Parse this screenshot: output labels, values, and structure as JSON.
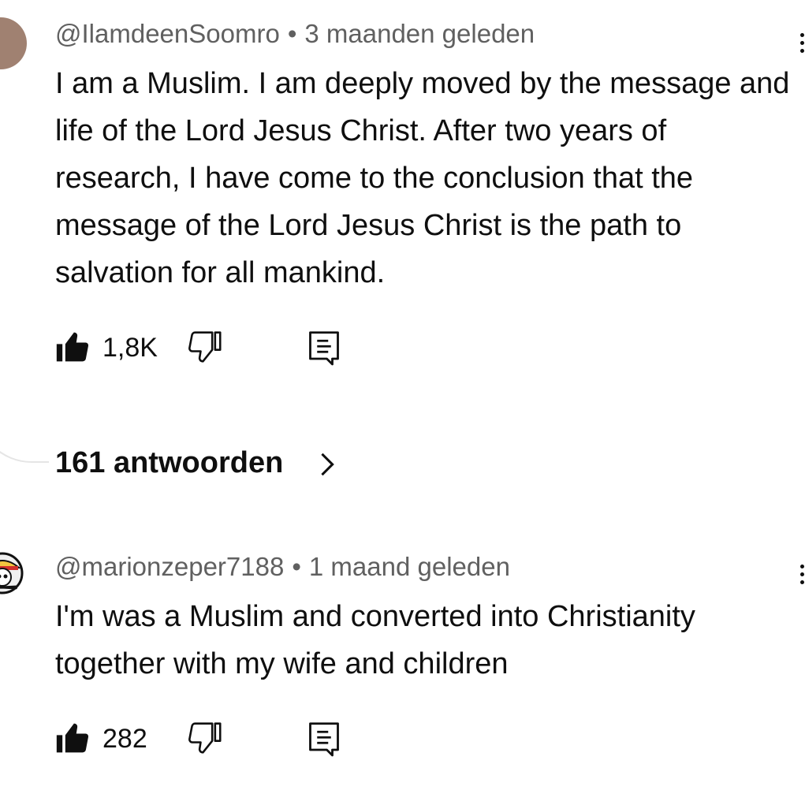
{
  "comments": [
    {
      "handle": "@IlamdeenSoomro",
      "separator": "•",
      "time": "3 maanden geleden",
      "text": "I am a Muslim. I am deeply moved by the message and life of the Lord Jesus Christ. After two years of research, I have come to the conclusion that the message of the Lord Jesus Christ is the path to salvation for all mankind.",
      "likes": "1,8K",
      "replies_label": "161 antwoorden"
    },
    {
      "handle": "@marionzeper7188",
      "separator": "•",
      "time": "1 maand geleden",
      "text": "I'm was a Muslim and converted into Christianity together with my wife and children",
      "likes": "282"
    }
  ],
  "icons": {
    "like": "thumbs-up-icon",
    "dislike": "thumbs-down-icon",
    "reply": "comment-reply-icon",
    "more": "vertical-dots-icon",
    "chevron": "chevron-right-icon"
  },
  "colors": {
    "text": "#0f0f0f",
    "meta": "#606060",
    "avatar1": "#a08171"
  }
}
